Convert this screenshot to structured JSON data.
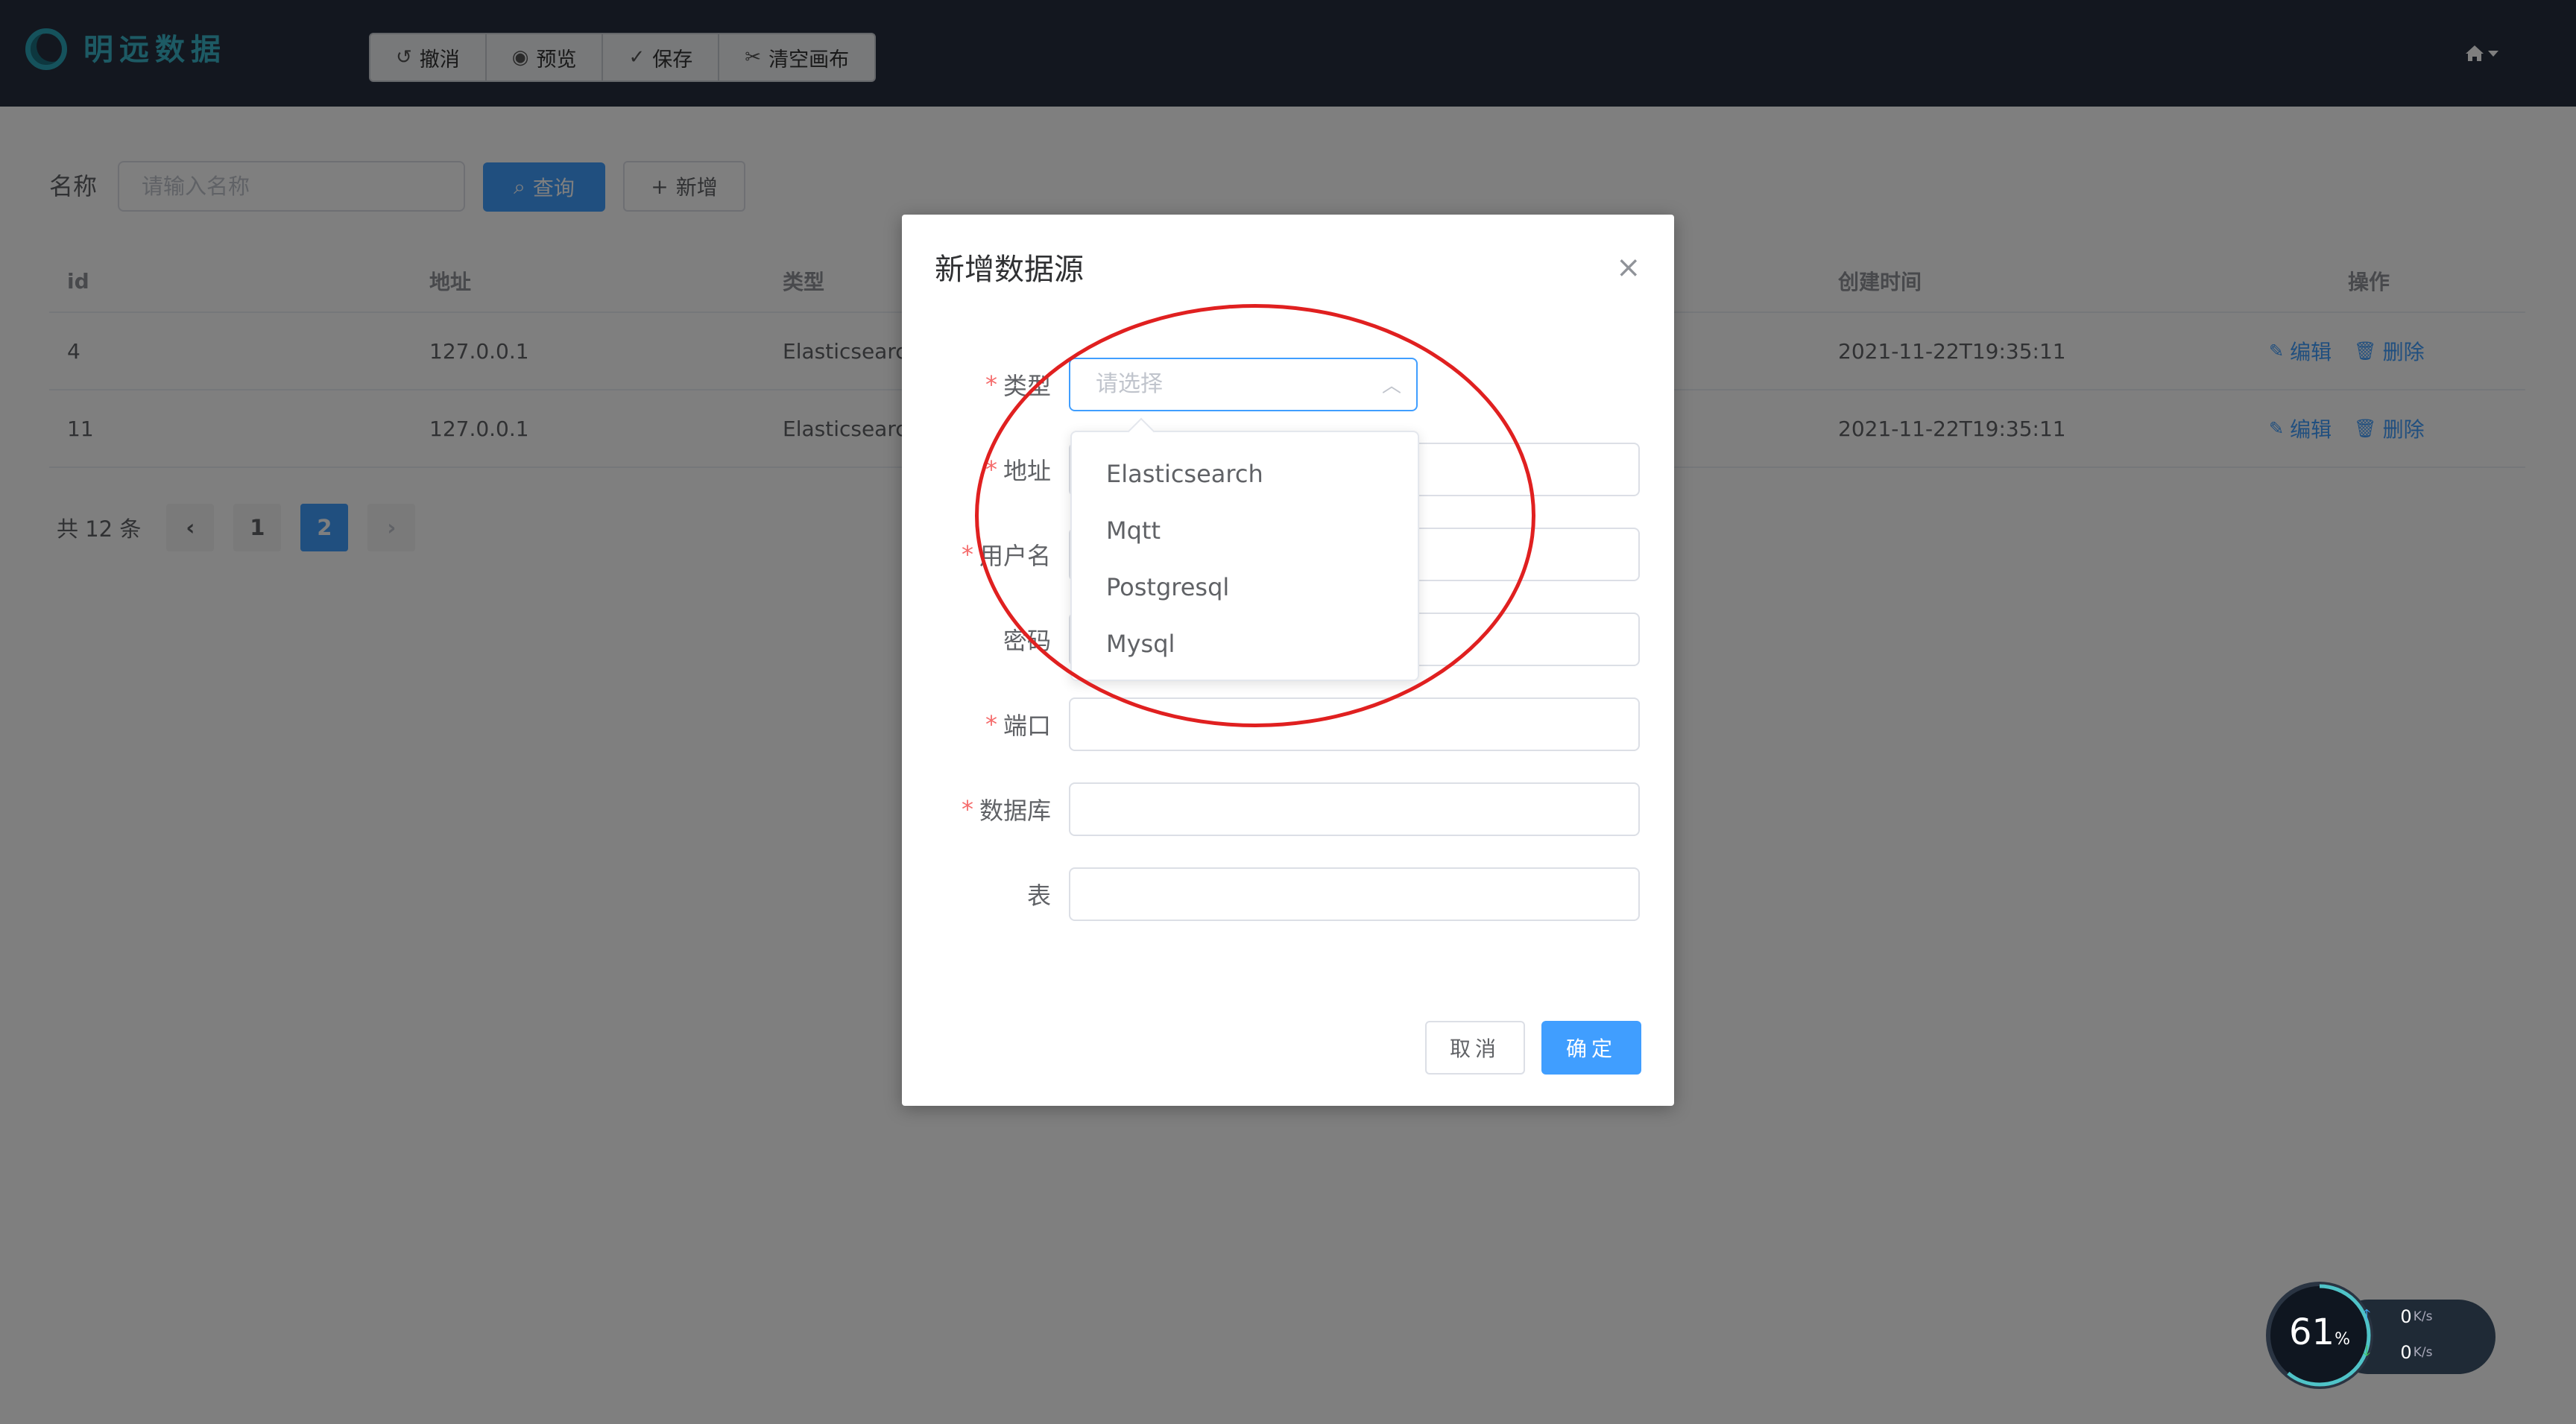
{
  "header": {
    "logo_text": "明远数据",
    "toolbar": [
      {
        "icon": "undo-icon",
        "glyph": "↺",
        "label": "撤消"
      },
      {
        "icon": "eye-icon",
        "glyph": "◉",
        "label": "预览"
      },
      {
        "icon": "save-icon",
        "glyph": "✓",
        "label": "保存"
      },
      {
        "icon": "scissors-icon",
        "glyph": "✂",
        "label": "清空画布"
      }
    ]
  },
  "search": {
    "label": "名称",
    "placeholder": "请输入名称",
    "query_label": "查询",
    "add_label": "新增"
  },
  "table": {
    "headers": [
      "id",
      "地址",
      "类型",
      "创建时间",
      "操作"
    ],
    "rows": [
      {
        "id": "4",
        "address": "127.0.0.1",
        "type": "Elasticsearch",
        "created": "2021-11-22T19:35:11",
        "edit": "编辑",
        "delete": "删除"
      },
      {
        "id": "11",
        "address": "127.0.0.1",
        "type": "Elasticsearch",
        "created": "2021-11-22T19:35:11",
        "edit": "编辑",
        "delete": "删除"
      }
    ]
  },
  "pager": {
    "total_text": "共 12 条",
    "pages": [
      "1",
      "2"
    ],
    "current": "2"
  },
  "dialog": {
    "title": "新增数据源",
    "fields": [
      {
        "label": "类型",
        "required": true,
        "type": "select",
        "placeholder": "请选择"
      },
      {
        "label": "地址",
        "required": true
      },
      {
        "label": "用户名",
        "required": true
      },
      {
        "label": "密码",
        "required": false
      },
      {
        "label": "端口",
        "required": true
      },
      {
        "label": "数据库",
        "required": true
      },
      {
        "label": "表",
        "required": false
      }
    ],
    "cancel_label": "取消",
    "ok_label": "确定"
  },
  "dropdown": {
    "options": [
      "Elasticsearch",
      "Mqtt",
      "Postgresql",
      "Mysql"
    ]
  },
  "widget": {
    "cpu_percent": "61",
    "cpu_unit": "%",
    "upload": "0",
    "download": "0",
    "rate_unit": "K/s"
  },
  "colors": {
    "primary": "#409eff",
    "header_bg": "#262e3f",
    "annotation": "#e02020",
    "required": "#f56c6c"
  }
}
